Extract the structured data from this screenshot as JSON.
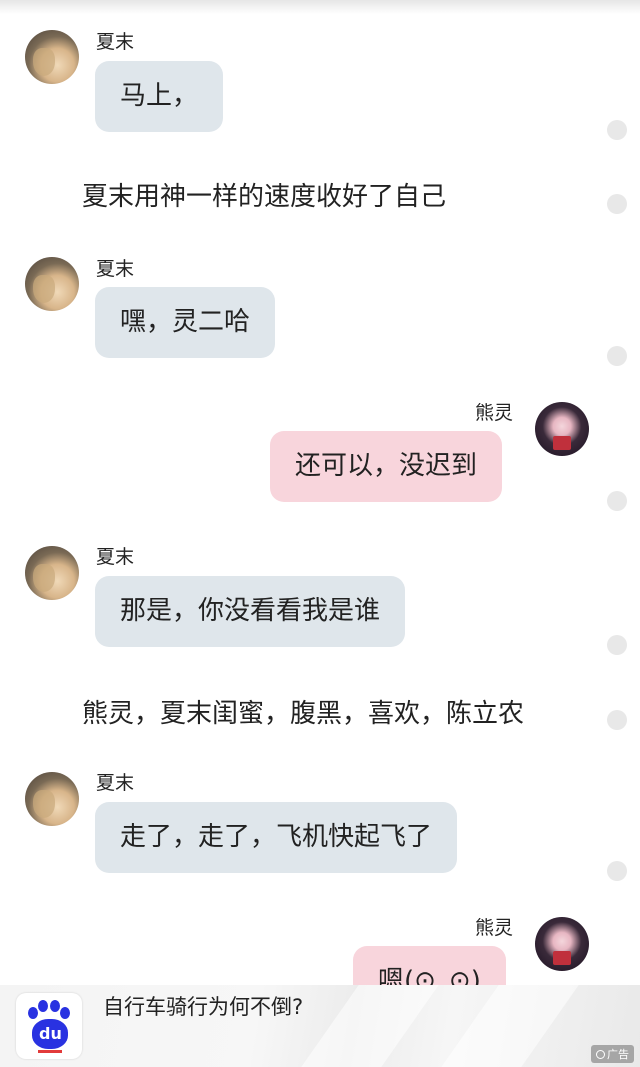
{
  "chat": {
    "messages": [
      {
        "side": "left",
        "name": "夏末",
        "text": "马上，"
      },
      {
        "type": "narration",
        "text": "夏末用神一样的速度收好了自己"
      },
      {
        "side": "left",
        "name": "夏末",
        "text": "嘿，灵二哈"
      },
      {
        "side": "right",
        "name": "熊灵",
        "text": "还可以，没迟到"
      },
      {
        "side": "left",
        "name": "夏末",
        "text": "那是，你没看看我是谁"
      },
      {
        "type": "narration",
        "text": "熊灵，夏末闺蜜，腹黑，喜欢，陈立农"
      },
      {
        "side": "left",
        "name": "夏末",
        "text": "走了，走了，飞机快起飞了"
      },
      {
        "side": "right",
        "name": "熊灵",
        "text": "嗯(⊙_⊙)"
      }
    ]
  },
  "ad": {
    "logo_text": "du",
    "title": "自行车骑行为何不倒?",
    "badge": "广告",
    "brand_color": "#2932e1"
  },
  "icons": {
    "left_avatar": "avatar-xiamo",
    "right_avatar": "avatar-xiongling",
    "dot": "grey-dot-icon",
    "ad_logo": "baidu-paw-icon"
  }
}
